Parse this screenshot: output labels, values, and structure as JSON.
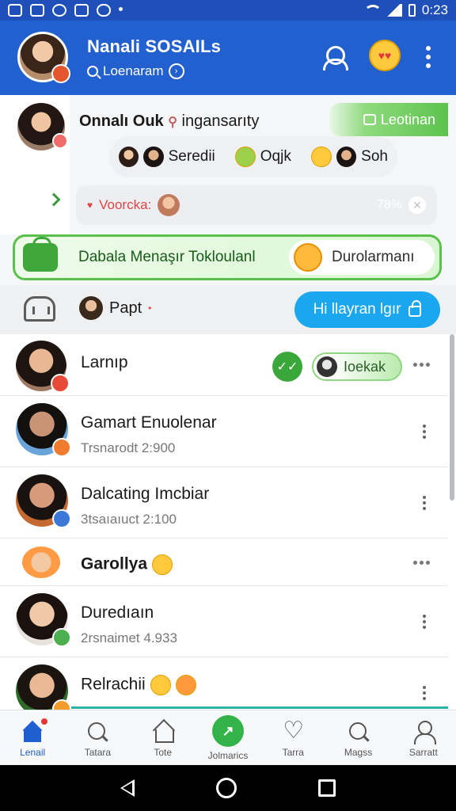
{
  "status_bar": {
    "time": "0:23",
    "icons": [
      "gallery-icon",
      "instagram-icon",
      "pinterest-icon",
      "shield-icon",
      "chat-icon",
      "dot-icon",
      "wifi-icon",
      "signal-icon",
      "battery-icon"
    ]
  },
  "header": {
    "title": "Nanali SOSAILs",
    "search_label": "Loenaram",
    "colors": {
      "background": "#2260cf",
      "status_bar": "#1f4fb8"
    }
  },
  "composer": {
    "name_bold": "Onnalı Ouk",
    "name_light": "ingansarıty",
    "green_pill_label": "Leotinan",
    "reactions": [
      {
        "label": "Seredii"
      },
      {
        "label": "Oqjk"
      },
      {
        "label": "Soh"
      }
    ],
    "mention_label": "Voorcka:",
    "mention_pct": "78%",
    "promo_label": "Dabala Menaşır Tokloulanl",
    "promo_right_label": "Durolarmanı"
  },
  "toolbar": {
    "user_label": "Papt",
    "action_label": "Hi llayran lgır"
  },
  "chats": [
    {
      "name": "Larnıp",
      "sub": "",
      "status_label": "Ioekak"
    },
    {
      "name": "Gamart Enuolenar",
      "sub": "Trsnarodt 2:900"
    },
    {
      "name": "Dalcating Imcbiar",
      "sub": "3tsaıaıuct 2:100"
    },
    {
      "name": "Garollya",
      "sub": ""
    },
    {
      "name": "Duredıaın",
      "sub": "2rsnaimet 4.933"
    },
    {
      "name": "Relrachii",
      "sub": ""
    }
  ],
  "bottom_nav": [
    {
      "label": "Lenail",
      "icon": "home-icon",
      "active": true
    },
    {
      "label": "Tatara",
      "icon": "search-icon",
      "active": false
    },
    {
      "label": "Tote",
      "icon": "house-outline-icon",
      "active": false
    },
    {
      "label": "Jolmarics",
      "icon": "trending-icon",
      "active": false
    },
    {
      "label": "Tarra",
      "icon": "heart-icon",
      "active": false
    },
    {
      "label": "Magss",
      "icon": "search-icon",
      "active": false
    },
    {
      "label": "Sarratt",
      "icon": "person-icon",
      "active": false
    }
  ]
}
